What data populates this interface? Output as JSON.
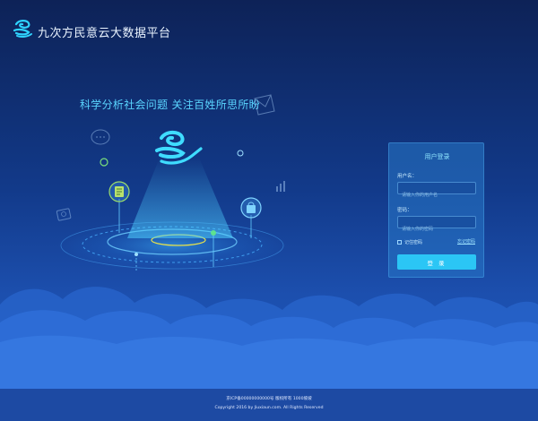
{
  "header": {
    "title": "九次方民意云大数据平台"
  },
  "hero": {
    "slogan": "科学分析社会问题 关注百姓所思所盼"
  },
  "login": {
    "title": "用户登录",
    "username_label": "用户名：",
    "username_placeholder": "请输入你的用户名",
    "password_label": "密码：",
    "password_placeholder": "请输入你的密码",
    "remember_label": "记住密码",
    "forgot_label": "忘记密码",
    "submit_label": "登 录"
  },
  "footer": {
    "line1": "京ICP备00000000000号 版权所有 1000坡坡",
    "line2": "Copyright 2016 by Jiuxiaun.com. All Rights Reserved"
  },
  "colors": {
    "accent": "#2bc6f5",
    "slogan": "#5ad5ff",
    "footer_bg": "#1d4aa3"
  }
}
